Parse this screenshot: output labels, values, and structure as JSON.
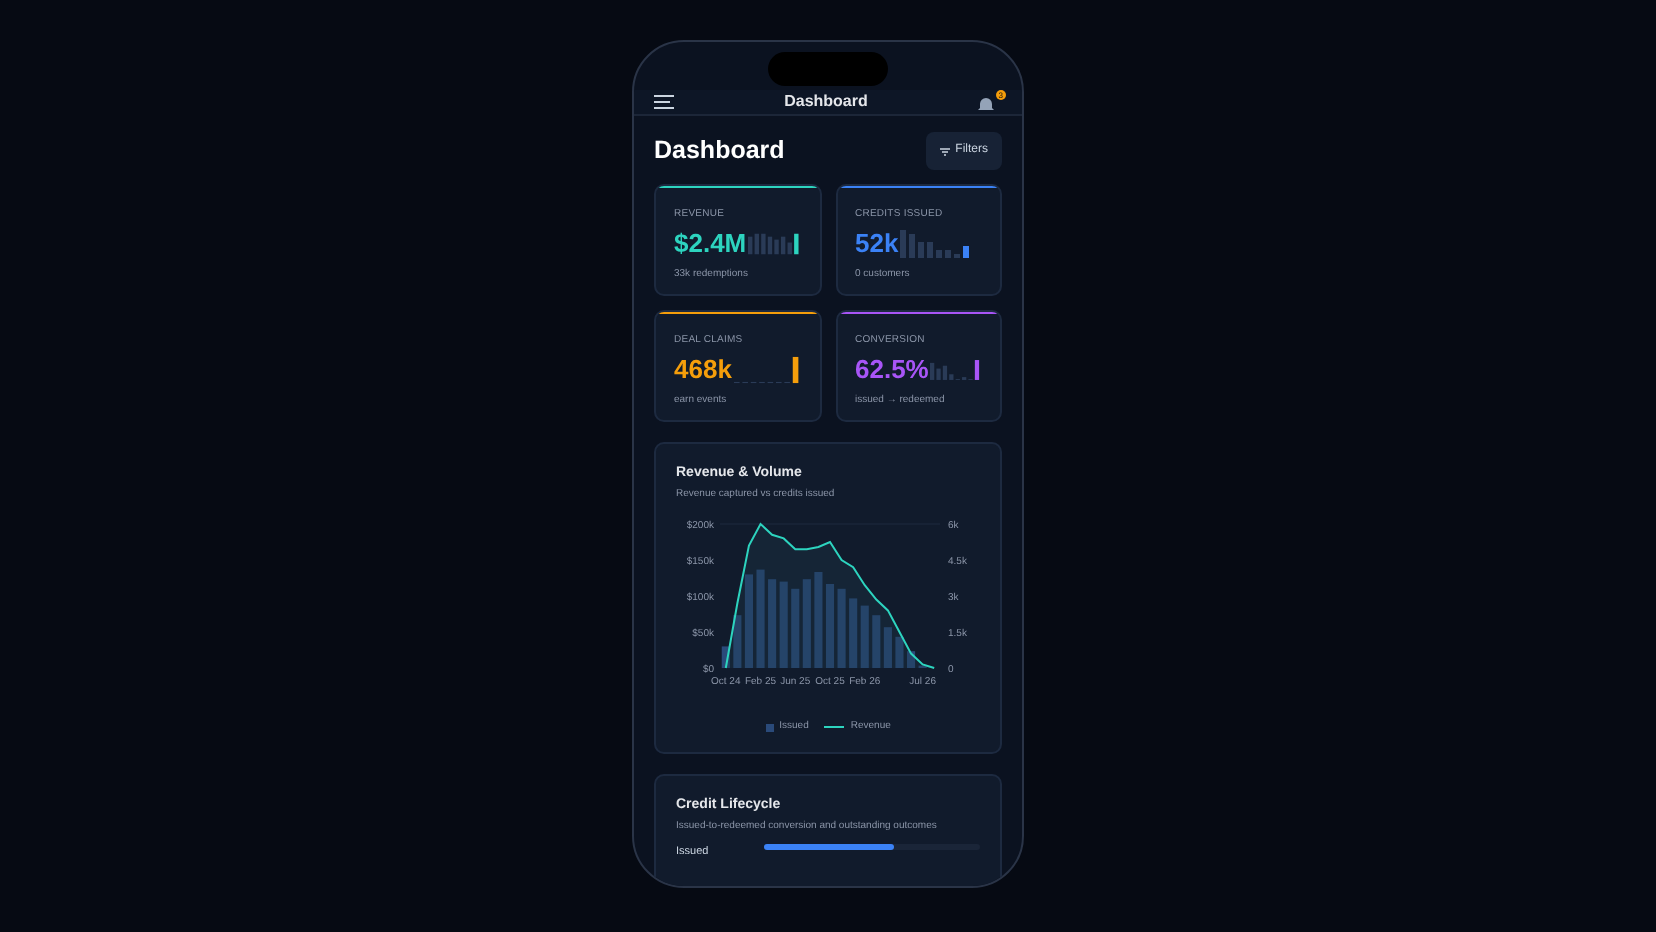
{
  "header": {
    "title": "Dashboard",
    "notification_count": "3"
  },
  "page": {
    "title": "Dashboard",
    "filters_label": "Filters"
  },
  "metrics": [
    {
      "label": "REVENUE",
      "value": "$2.4M",
      "sub": "33k redemptions",
      "color": "#2dd4bf"
    },
    {
      "label": "CREDITS ISSUED",
      "value": "52k",
      "sub": "0 customers",
      "color": "#3b82f6"
    },
    {
      "label": "DEAL CLAIMS",
      "value": "468k",
      "sub": "earn events",
      "color": "#f59e0b"
    },
    {
      "label": "CONVERSION",
      "value": "62.5%",
      "sub": "issued → redeemed",
      "color": "#a855f7"
    }
  ],
  "chart_card": {
    "title": "Revenue & Volume",
    "subtitle": "Revenue captured vs credits issued",
    "chart_data": {
      "type": "bar",
      "categories": [
        "Oct 24",
        null,
        null,
        "Feb 25",
        null,
        null,
        "Jun 25",
        null,
        null,
        "Oct 25",
        null,
        null,
        "Feb 26",
        null,
        null,
        null,
        null,
        "Jul 26",
        null
      ],
      "ylim": [
        0,
        200
      ],
      "y2lim": [
        0,
        6000
      ],
      "series": [
        {
          "name": "Issued",
          "type": "bar",
          "axis": "y2",
          "color": "#2a4a7a",
          "values": [
            900,
            2200,
            3900,
            4100,
            3700,
            3600,
            3300,
            3700,
            4000,
            3500,
            3300,
            2900,
            2600,
            2200,
            1700,
            1300,
            700,
            100,
            0
          ]
        },
        {
          "name": "Revenue",
          "type": "line",
          "axis": "y",
          "color": "#2dd4bf",
          "values": [
            0,
            90,
            170,
            200,
            185,
            180,
            165,
            165,
            168,
            175,
            150,
            140,
            115,
            95,
            80,
            50,
            20,
            5,
            0
          ]
        }
      ],
      "yticks": [
        {
          "value": 0,
          "label": "$0"
        },
        {
          "value": 50,
          "label": "$50k"
        },
        {
          "value": 100,
          "label": "$100k"
        },
        {
          "value": 150,
          "label": "$150k"
        },
        {
          "value": 200,
          "label": "$200k"
        }
      ],
      "y2ticks": [
        {
          "value": 0,
          "label": "0"
        },
        {
          "value": 1500,
          "label": "1.5k"
        },
        {
          "value": 3000,
          "label": "3k"
        },
        {
          "value": 4500,
          "label": "4.5k"
        },
        {
          "value": 6000,
          "label": "6k"
        }
      ]
    }
  },
  "lifecycle_card": {
    "title": "Credit Lifecycle",
    "subtitle": "Issued-to-redeemed conversion and outstanding outcomes",
    "rows": [
      {
        "label": "Issued",
        "level": 0.6
      }
    ]
  }
}
